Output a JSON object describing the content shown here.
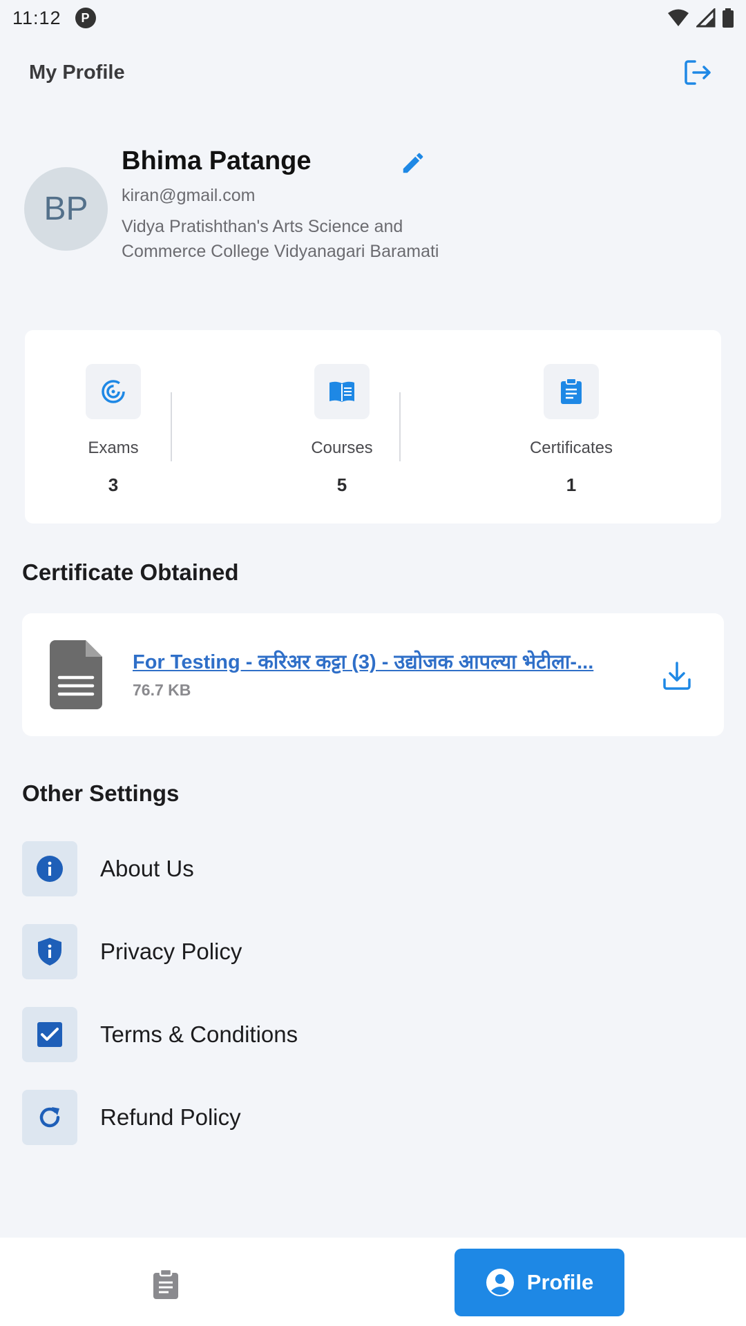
{
  "status_bar": {
    "time": "11:12"
  },
  "header": {
    "title": "My Profile"
  },
  "profile": {
    "initials": "BP",
    "name": "Bhima Patange",
    "email": "kiran@gmail.com",
    "college": "Vidya Pratishthan's Arts Science and Commerce College Vidyanagari Baramati"
  },
  "stats": [
    {
      "label": "Exams",
      "value": "3",
      "icon": "target-icon"
    },
    {
      "label": "Courses",
      "value": "5",
      "icon": "book-icon"
    },
    {
      "label": "Certificates",
      "value": "1",
      "icon": "clipboard-icon"
    }
  ],
  "certificates": {
    "title": "Certificate Obtained",
    "items": [
      {
        "name": "For Testing - करिअर कट्टा (3) - उद्योजक आपल्या भेटीला-...",
        "size": "76.7 KB"
      }
    ]
  },
  "settings": {
    "title": "Other Settings",
    "items": [
      {
        "label": "About Us",
        "icon": "info-icon"
      },
      {
        "label": "Privacy Policy",
        "icon": "shield-icon"
      },
      {
        "label": "Terms & Conditions",
        "icon": "checkbox-icon"
      },
      {
        "label": "Refund Policy",
        "icon": "refresh-icon"
      }
    ]
  },
  "bottom_nav": {
    "profile_label": "Profile"
  },
  "colors": {
    "accent": "#1e88e5",
    "link": "#2f6fc8",
    "background": "#f3f5f9"
  }
}
